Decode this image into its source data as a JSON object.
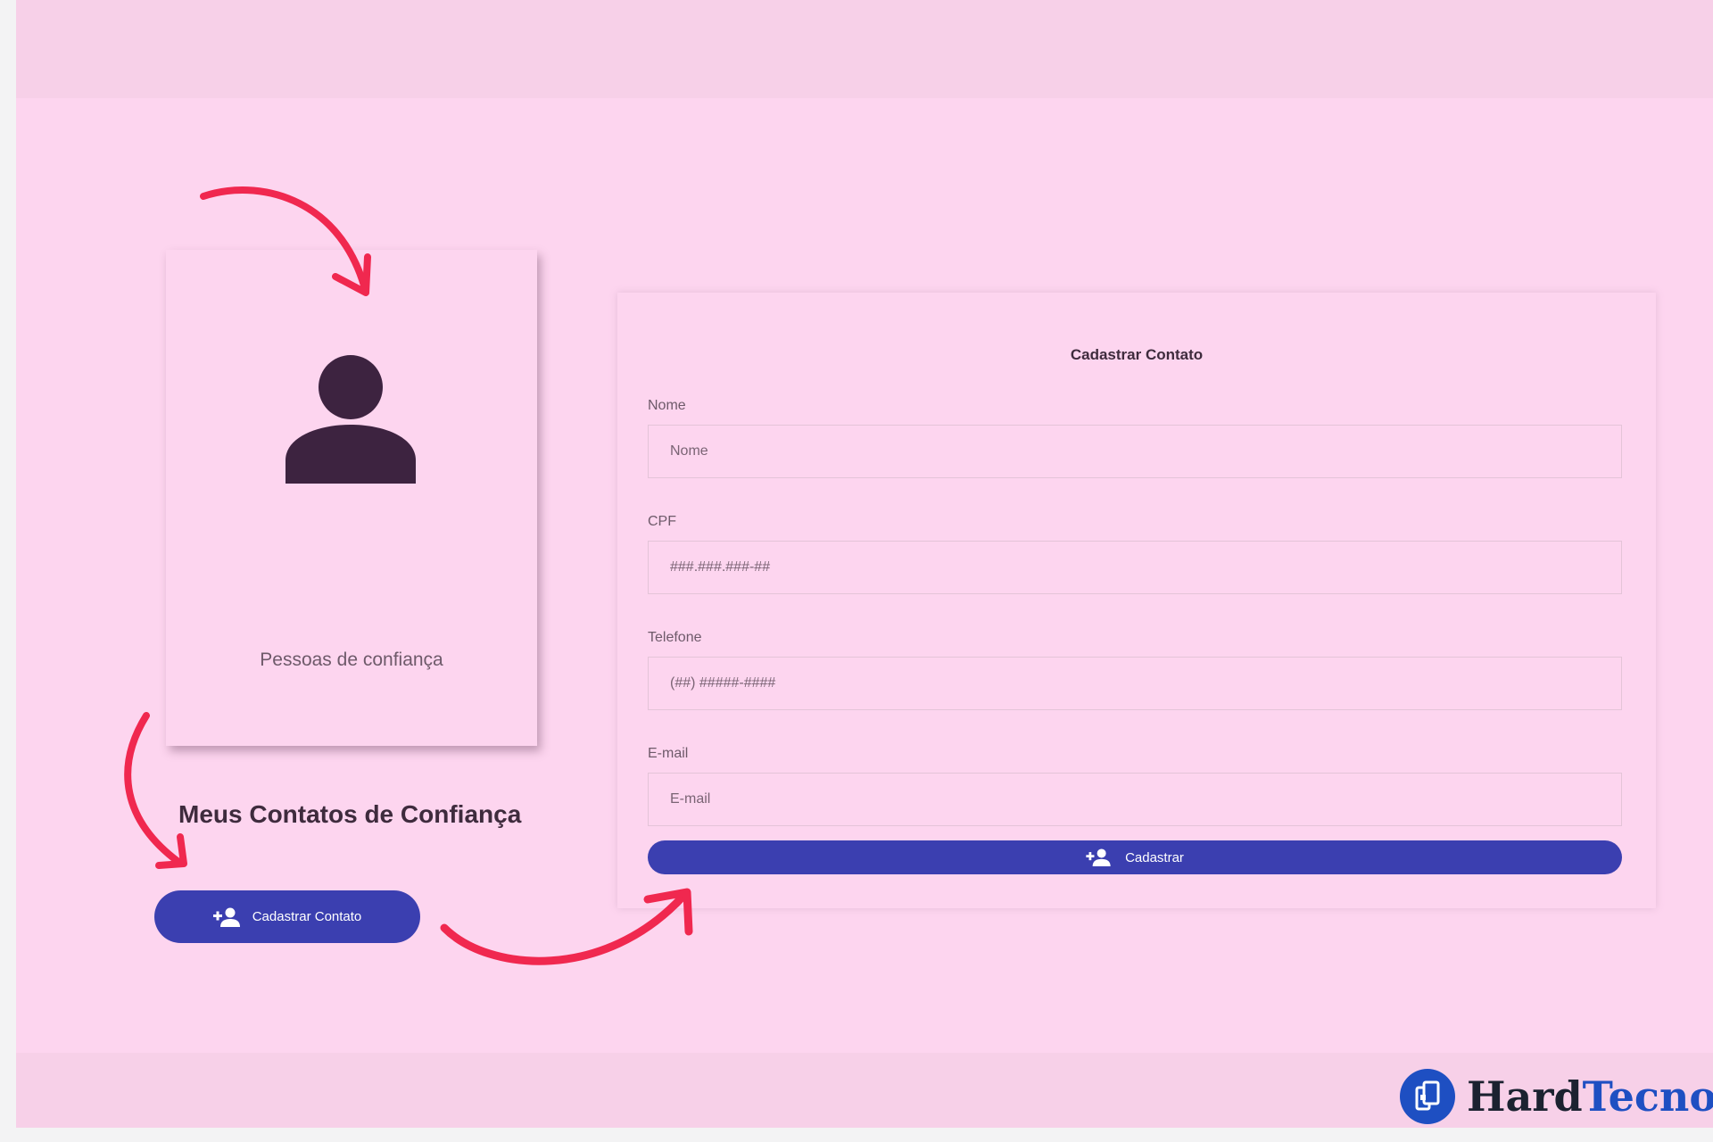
{
  "profile_card": {
    "caption": "Pessoas de confiança",
    "avatar_icon": "person-icon"
  },
  "section": {
    "title": "Meus Contatos de Confiança"
  },
  "register_contact_button": {
    "label": "Cadastrar Contato",
    "icon": "add-person-icon"
  },
  "form": {
    "title": "Cadastrar Contato",
    "fields": [
      {
        "label": "Nome",
        "placeholder": "Nome"
      },
      {
        "label": "CPF",
        "placeholder": "###.###.###-##"
      },
      {
        "label": "Telefone",
        "placeholder": "(##) #####-####"
      },
      {
        "label": "E-mail",
        "placeholder": "E-mail"
      }
    ],
    "submit_label": "Cadastrar",
    "submit_icon": "add-person-icon"
  },
  "logo": {
    "part1": "Hard",
    "part2": "Tecno",
    "icon": "phone-logo-icon"
  },
  "colors": {
    "background": "#fdd5ef",
    "band": "#f7d0e8",
    "button": "#3b3fb0",
    "arrow": "#f0284f",
    "avatar": "#3d2340",
    "logo_blue": "#1e4fc2"
  }
}
